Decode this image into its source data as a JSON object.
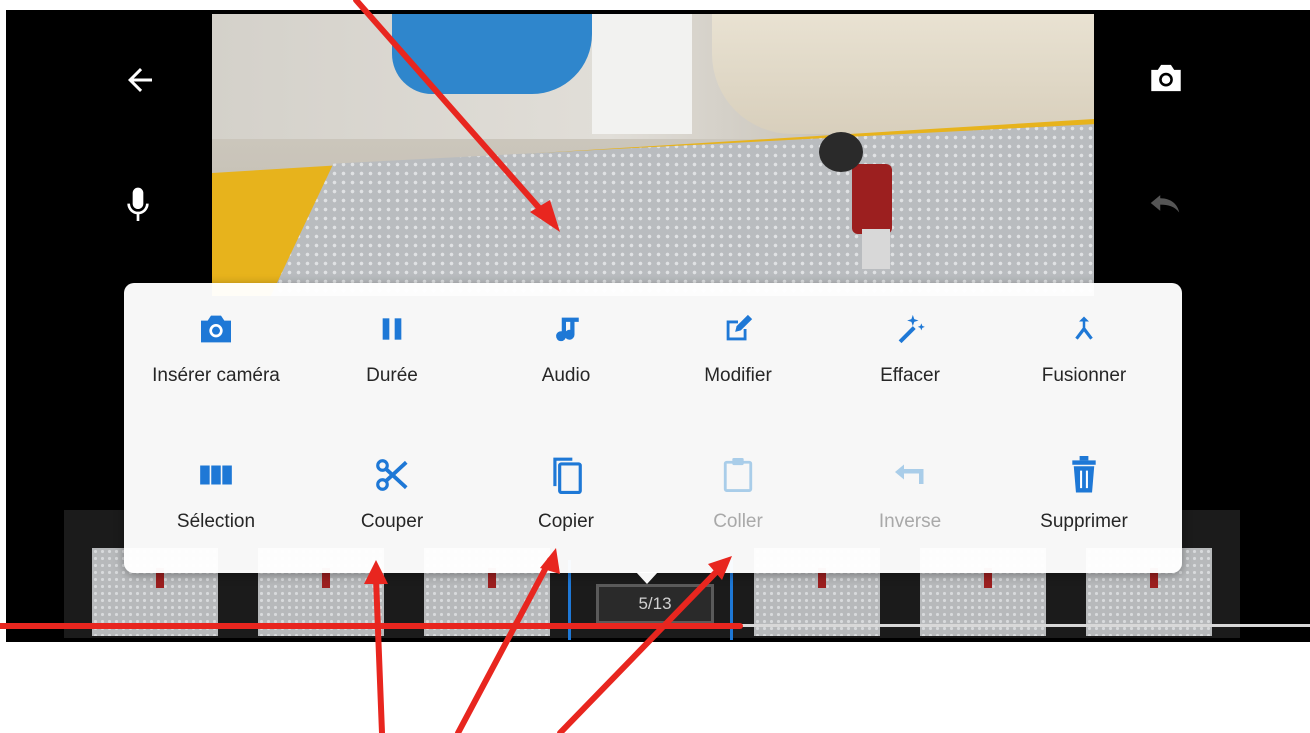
{
  "menu": {
    "rows": [
      [
        {
          "label": "Insérer caméra",
          "icon": "camera-icon",
          "enabled": true
        },
        {
          "label": "Durée",
          "icon": "pause-icon",
          "enabled": true
        },
        {
          "label": "Audio",
          "icon": "music-note-icon",
          "enabled": true
        },
        {
          "label": "Modifier",
          "icon": "edit-icon",
          "enabled": true
        },
        {
          "label": "Effacer",
          "icon": "magic-wand-icon",
          "enabled": true
        },
        {
          "label": "Fusionner",
          "icon": "merge-icon",
          "enabled": true
        }
      ],
      [
        {
          "label": "Sélection",
          "icon": "columns-icon",
          "enabled": true
        },
        {
          "label": "Couper",
          "icon": "scissors-icon",
          "enabled": true
        },
        {
          "label": "Copier",
          "icon": "copy-icon",
          "enabled": true
        },
        {
          "label": "Coller",
          "icon": "clipboard-icon",
          "enabled": false
        },
        {
          "label": "Inverse",
          "icon": "reverse-icon",
          "enabled": false
        },
        {
          "label": "Supprimer",
          "icon": "trash-icon",
          "enabled": true
        }
      ]
    ]
  },
  "timeline": {
    "frame_counter": "5/13",
    "current_frame": 5,
    "total_frames": 13
  },
  "colors": {
    "accent": "#1e78d6",
    "disabled": "#a9cde9",
    "annotation": "#e8261f"
  }
}
